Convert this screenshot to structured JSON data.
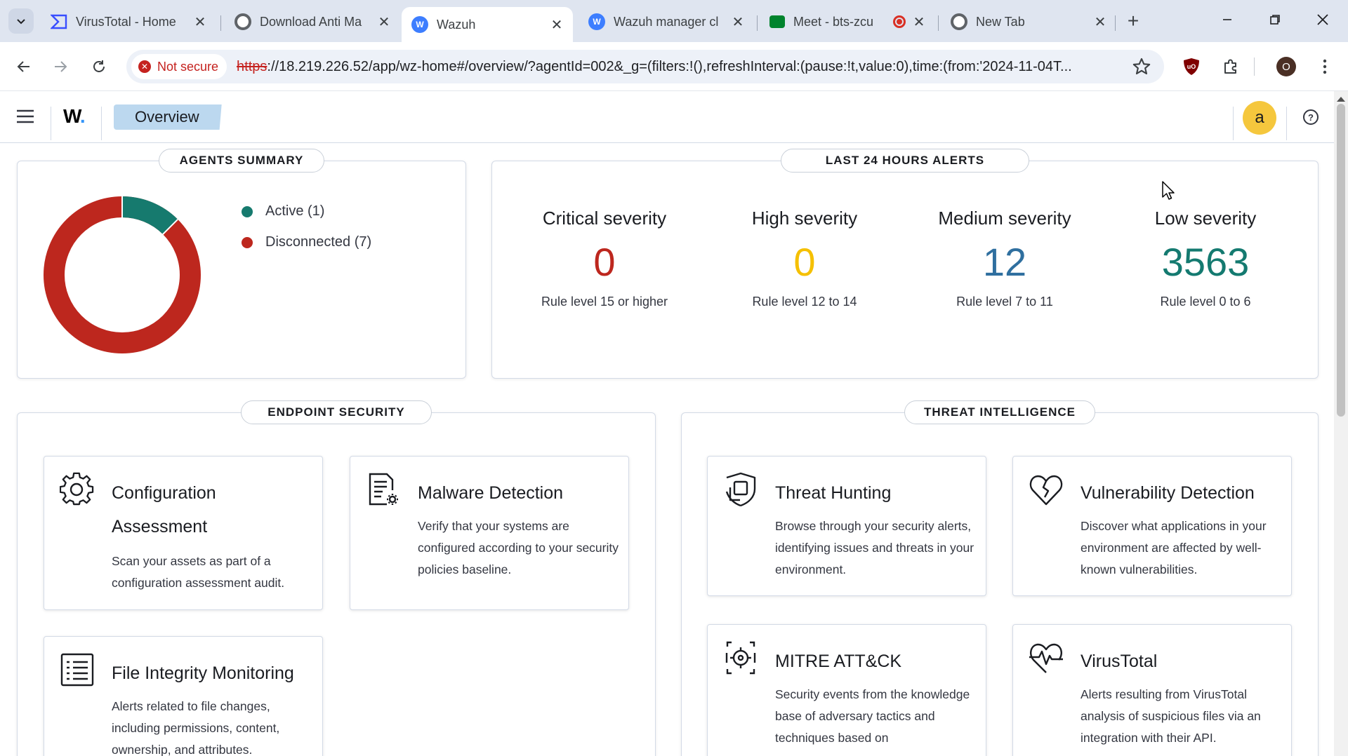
{
  "browser": {
    "tabs": [
      {
        "title": "VirusTotal - Home",
        "icon": "virustotal-icon"
      },
      {
        "title": "Download Anti Ma",
        "icon": "chrome-icon"
      },
      {
        "title": "Wazuh",
        "icon": "wazuh-icon"
      },
      {
        "title": "Wazuh manager cl",
        "icon": "wazuh-icon"
      },
      {
        "title": "Meet - bts-zcu",
        "icon": "meet-icon"
      },
      {
        "title": "New Tab",
        "icon": "chrome-icon"
      }
    ],
    "active_tab": 2,
    "security_label": "Not secure",
    "url_protocol": "https",
    "url_rest": "://18.219.226.52/app/wz-home#/overview/?agentId=002&_g=(filters:!(),refreshInterval:(pause:!t,value:0),time:(from:'2024-11-04T...",
    "profile_initial": "O"
  },
  "app": {
    "logo_text": "W",
    "breadcrumb": "Overview",
    "user_initial": "a",
    "help_symbol": "?"
  },
  "agents_summary": {
    "title": "AGENTS SUMMARY",
    "items": [
      {
        "label": "Active (1)",
        "count": 1,
        "color": "#167a6e"
      },
      {
        "label": "Disconnected (7)",
        "count": 7,
        "color": "#bd271e"
      }
    ]
  },
  "alerts": {
    "title": "LAST 24 HOURS ALERTS",
    "items": [
      {
        "label": "Critical severity",
        "value": "0",
        "sub": "Rule level 15 or higher",
        "color": "#bd271e"
      },
      {
        "label": "High severity",
        "value": "0",
        "sub": "Rule level 12 to 14",
        "color": "#f5c000"
      },
      {
        "label": "Medium severity",
        "value": "12",
        "sub": "Rule level 7 to 11",
        "color": "#2f6f9f"
      },
      {
        "label": "Low severity",
        "value": "3563",
        "sub": "Rule level 0 to 6",
        "color": "#147a70"
      }
    ]
  },
  "endpoint_security": {
    "title": "ENDPOINT SECURITY",
    "cards": [
      {
        "title": "Configuration Assessment",
        "desc": "Scan your assets as part of a configuration assessment audit.",
        "icon": "gear-icon"
      },
      {
        "title": "Malware Detection",
        "desc": "Verify that your systems are configured according to your security policies baseline.",
        "icon": "document-gear-icon"
      },
      {
        "title": "File Integrity Monitoring",
        "desc": "Alerts related to file changes, including permissions, content, ownership, and attributes.",
        "icon": "list-document-icon"
      }
    ]
  },
  "threat_intelligence": {
    "title": "THREAT INTELLIGENCE",
    "cards": [
      {
        "title": "Threat Hunting",
        "desc": "Browse through your security alerts, identifying issues and threats in your environment.",
        "icon": "shield-search-icon"
      },
      {
        "title": "Vulnerability Detection",
        "desc": "Discover what applications in your environment are affected by well-known vulnerabilities.",
        "icon": "heart-broken-icon"
      },
      {
        "title": "MITRE ATT&CK",
        "desc": "Security events from the knowledge base of adversary tactics and techniques based on",
        "icon": "target-icon"
      },
      {
        "title": "VirusTotal",
        "desc": "Alerts resulting from VirusTotal analysis of suspicious files via an integration with their API.",
        "icon": "heart-pulse-icon"
      }
    ]
  }
}
